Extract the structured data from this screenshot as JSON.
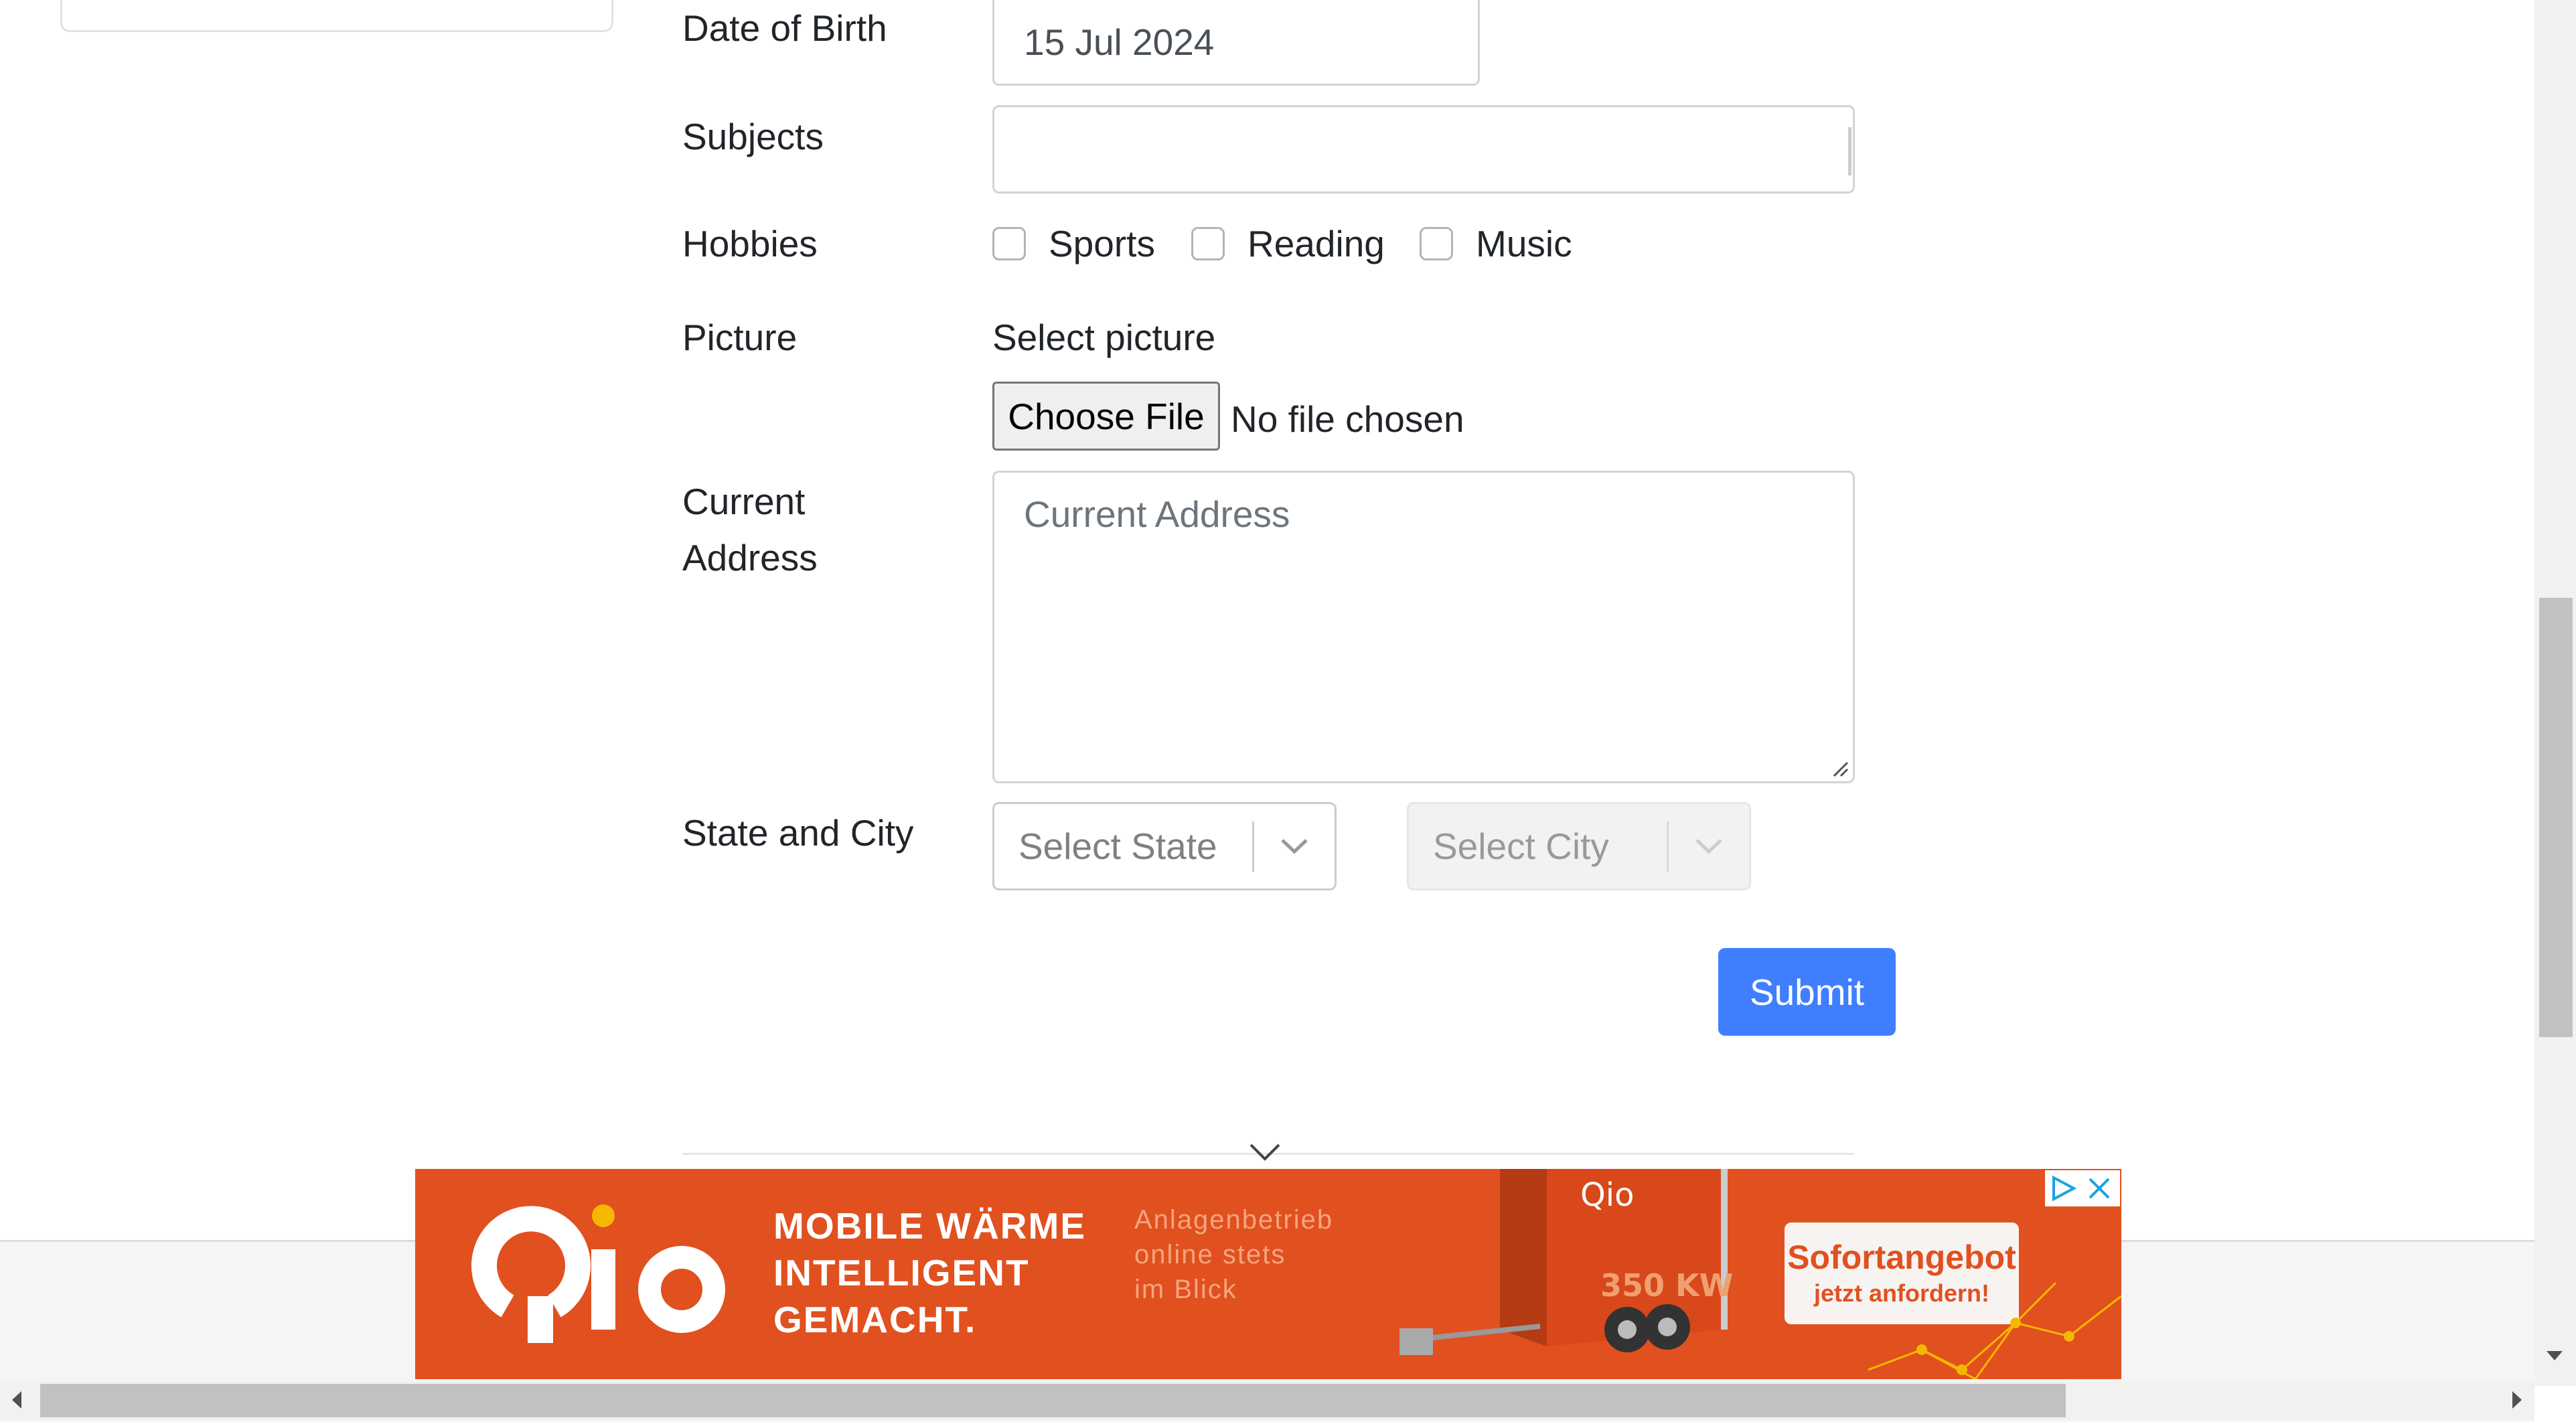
{
  "form": {
    "dob_label": "Date of Birth",
    "dob_value": "15 Jul 2024",
    "subjects_label": "Subjects",
    "subjects_value": "",
    "hobbies_label": "Hobbies",
    "hobbies": [
      {
        "label": "Sports",
        "checked": false
      },
      {
        "label": "Reading",
        "checked": false
      },
      {
        "label": "Music",
        "checked": false
      }
    ],
    "picture_label": "Picture",
    "picture_select_text": "Select picture",
    "file_button": "Choose File",
    "file_status": "No file chosen",
    "address_label_line1": "Current",
    "address_label_line2": "Address",
    "address_placeholder": "Current Address",
    "state_city_label": "State and City",
    "state_placeholder": "Select State",
    "city_placeholder": "Select City",
    "submit_label": "Submit"
  },
  "ad": {
    "headline": [
      "MOBILE WÄRME",
      "INTELLIGENT",
      "GEMACHT."
    ],
    "subline": [
      "Anlagenbetrieb",
      "online stets",
      "im Blick"
    ],
    "cta_line1": "Sofortangebot",
    "cta_line2": "jetzt anfordern!",
    "brand_logo_text": "Qio",
    "trailer_brand": "Qio",
    "trailer_power": "350 KW"
  },
  "colors": {
    "accent": "#3f7fff",
    "ad_background": "#e1501f",
    "ad_logo_dot": "#f5b800"
  }
}
